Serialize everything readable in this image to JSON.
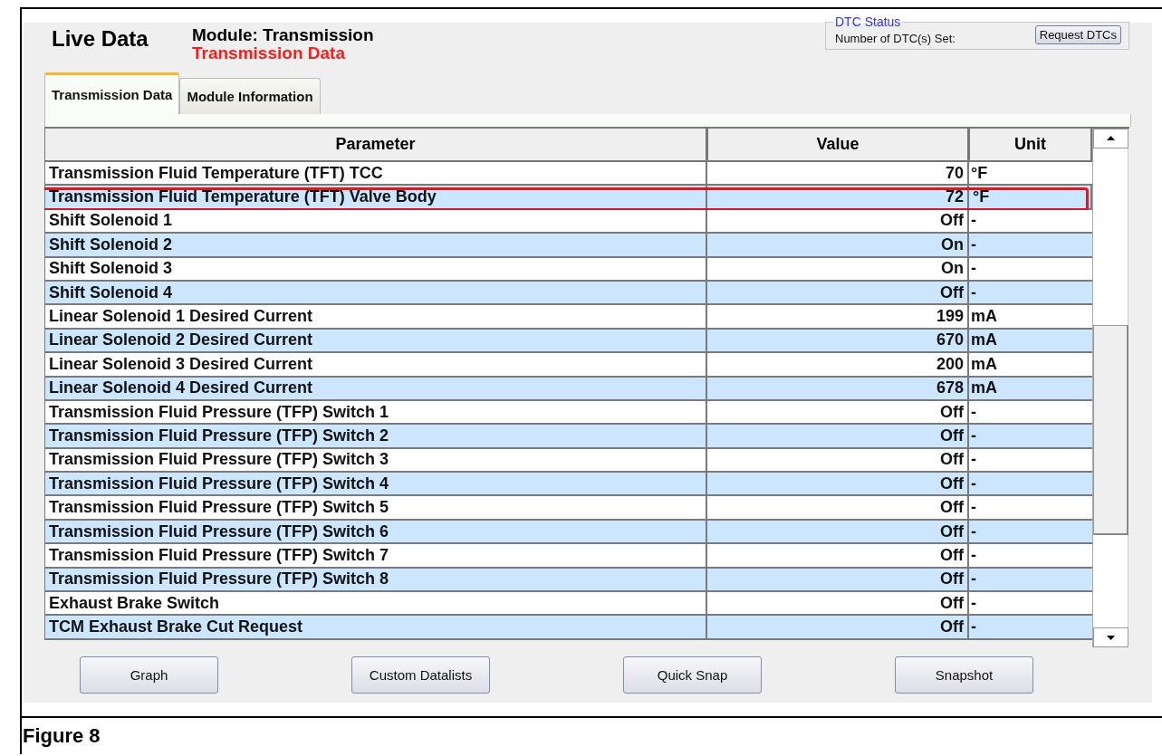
{
  "header": {
    "title": "Live Data",
    "module": "Module: Transmission",
    "dataset": "Transmission Data"
  },
  "dtc_status": {
    "legend": "DTC Status",
    "label": "Number of DTC(s) Set:",
    "button": "Request DTCs"
  },
  "tabs": [
    {
      "label": "Transmission Data",
      "selected": true
    },
    {
      "label": "Module Information",
      "selected": false
    }
  ],
  "table": {
    "columns": [
      "Parameter",
      "Value",
      "Unit"
    ],
    "rows": [
      {
        "parameter": "Transmission Fluid Temperature (TFT) TCC",
        "value": "70",
        "unit": "°F",
        "highlighted": false
      },
      {
        "parameter": "Transmission Fluid Temperature (TFT) Valve Body",
        "value": "72",
        "unit": "°F",
        "highlighted": true
      },
      {
        "parameter": "Shift Solenoid 1",
        "value": "Off",
        "unit": "-",
        "highlighted": false
      },
      {
        "parameter": "Shift Solenoid 2",
        "value": "On",
        "unit": "-",
        "highlighted": false
      },
      {
        "parameter": "Shift Solenoid 3",
        "value": "On",
        "unit": "-",
        "highlighted": false
      },
      {
        "parameter": "Shift Solenoid 4",
        "value": "Off",
        "unit": "-",
        "highlighted": false
      },
      {
        "parameter": "Linear Solenoid 1 Desired Current",
        "value": "199",
        "unit": "mA",
        "highlighted": false
      },
      {
        "parameter": "Linear Solenoid 2 Desired Current",
        "value": "670",
        "unit": "mA",
        "highlighted": false
      },
      {
        "parameter": "Linear Solenoid 3 Desired Current",
        "value": "200",
        "unit": "mA",
        "highlighted": false
      },
      {
        "parameter": "Linear Solenoid 4 Desired Current",
        "value": "678",
        "unit": "mA",
        "highlighted": false
      },
      {
        "parameter": "Transmission Fluid Pressure (TFP) Switch 1",
        "value": "Off",
        "unit": "-",
        "highlighted": false
      },
      {
        "parameter": "Transmission Fluid Pressure (TFP) Switch 2",
        "value": "Off",
        "unit": "-",
        "highlighted": false
      },
      {
        "parameter": "Transmission Fluid Pressure (TFP) Switch 3",
        "value": "Off",
        "unit": "-",
        "highlighted": false
      },
      {
        "parameter": "Transmission Fluid Pressure (TFP) Switch 4",
        "value": "Off",
        "unit": "-",
        "highlighted": false
      },
      {
        "parameter": "Transmission Fluid Pressure (TFP) Switch 5",
        "value": "Off",
        "unit": "-",
        "highlighted": false
      },
      {
        "parameter": "Transmission Fluid Pressure (TFP) Switch 6",
        "value": "Off",
        "unit": "-",
        "highlighted": false
      },
      {
        "parameter": "Transmission Fluid Pressure (TFP) Switch 7",
        "value": "Off",
        "unit": "-",
        "highlighted": false
      },
      {
        "parameter": "Transmission Fluid Pressure (TFP) Switch 8",
        "value": "Off",
        "unit": "-",
        "highlighted": false
      },
      {
        "parameter": "Exhaust Brake Switch",
        "value": "Off",
        "unit": "-",
        "highlighted": false
      },
      {
        "parameter": "TCM Exhaust Brake Cut Request",
        "value": "Off",
        "unit": "-",
        "highlighted": false
      }
    ]
  },
  "buttons": [
    "Graph",
    "Custom Datalists",
    "Quick Snap",
    "Snapshot"
  ],
  "caption": "Figure 8"
}
